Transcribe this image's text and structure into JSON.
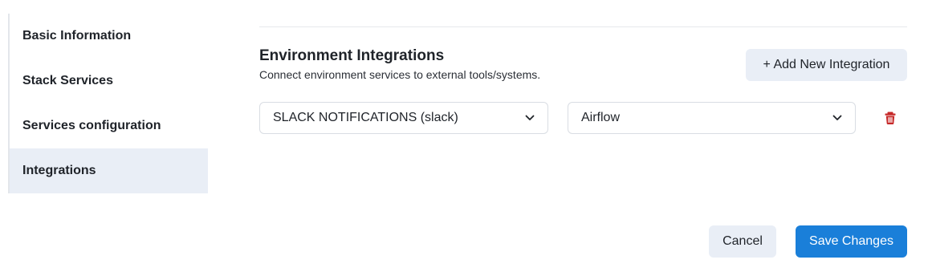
{
  "sidebar": {
    "items": [
      {
        "label": "Basic Information",
        "active": false
      },
      {
        "label": "Stack Services",
        "active": false
      },
      {
        "label": "Services configuration",
        "active": false
      },
      {
        "label": "Integrations",
        "active": true
      }
    ]
  },
  "section": {
    "title": "Environment Integrations",
    "subtitle": "Connect environment services to external tools/systems.",
    "add_button_label": "+ Add New Integration"
  },
  "integration_row": {
    "integration_select": {
      "value": "SLACK NOTIFICATIONS (slack)",
      "icon": "chevron-down-icon"
    },
    "service_select": {
      "value": "Airflow",
      "icon": "chevron-down-icon"
    },
    "delete_icon": "trash-icon"
  },
  "footer": {
    "cancel_label": "Cancel",
    "save_label": "Save Changes"
  },
  "colors": {
    "primary": "#1a7fd9",
    "secondary_button_bg": "#e9eef6",
    "danger": "#c62828",
    "active_nav_bg": "#e9eef6"
  }
}
